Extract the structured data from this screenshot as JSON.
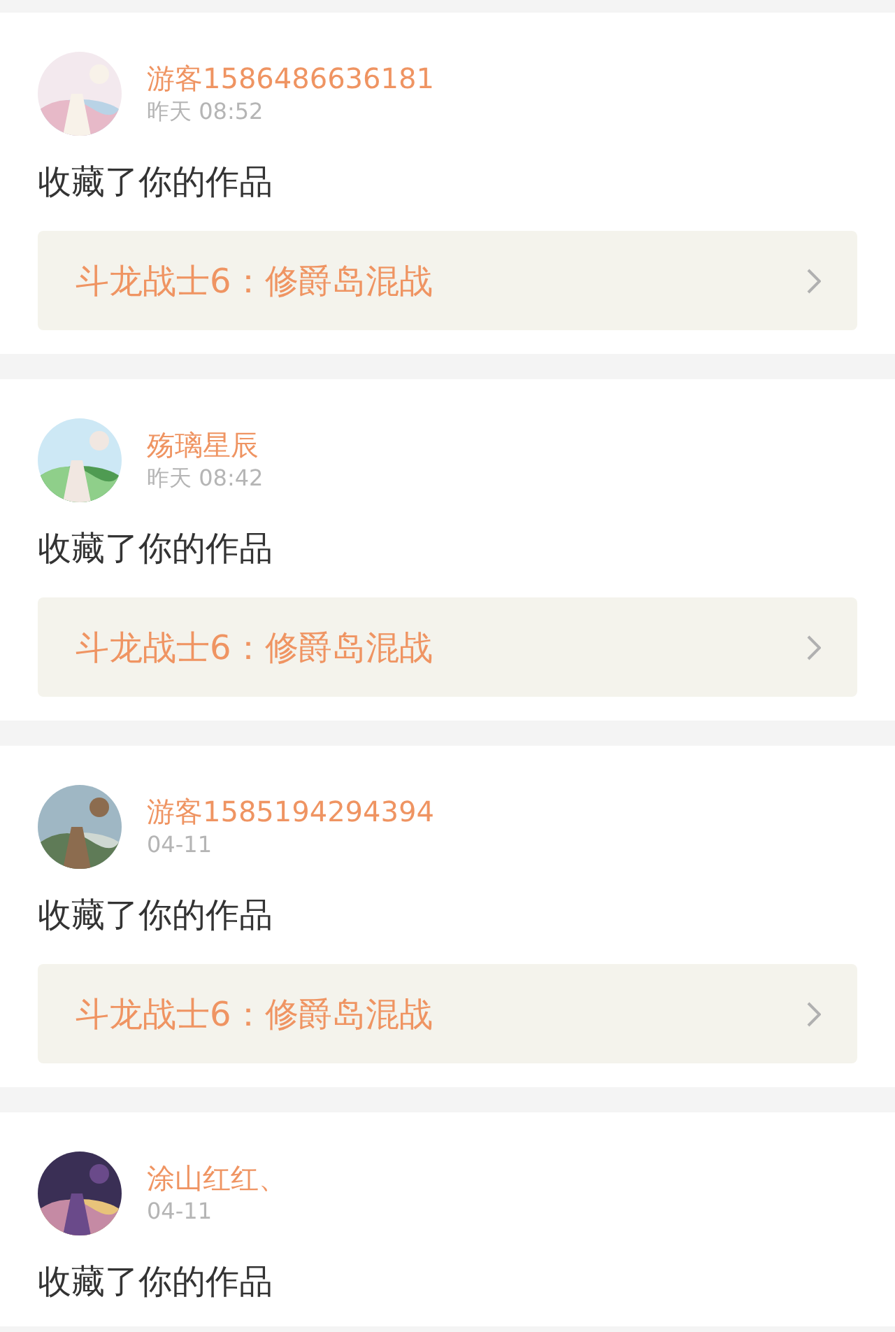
{
  "notifications": [
    {
      "user": "游客1586486636181",
      "time": "昨天 08:52",
      "message": "收藏了你的作品",
      "work": "斗龙战士6：修爵岛混战"
    },
    {
      "user": "殇璃星辰",
      "time": "昨天 08:42",
      "message": "收藏了你的作品",
      "work": "斗龙战士6：修爵岛混战"
    },
    {
      "user": "游客1585194294394",
      "time": "04-11",
      "message": "收藏了你的作品",
      "work": "斗龙战士6：修爵岛混战"
    },
    {
      "user": "涂山红红、",
      "time": "04-11",
      "message": "收藏了你的作品"
    }
  ]
}
